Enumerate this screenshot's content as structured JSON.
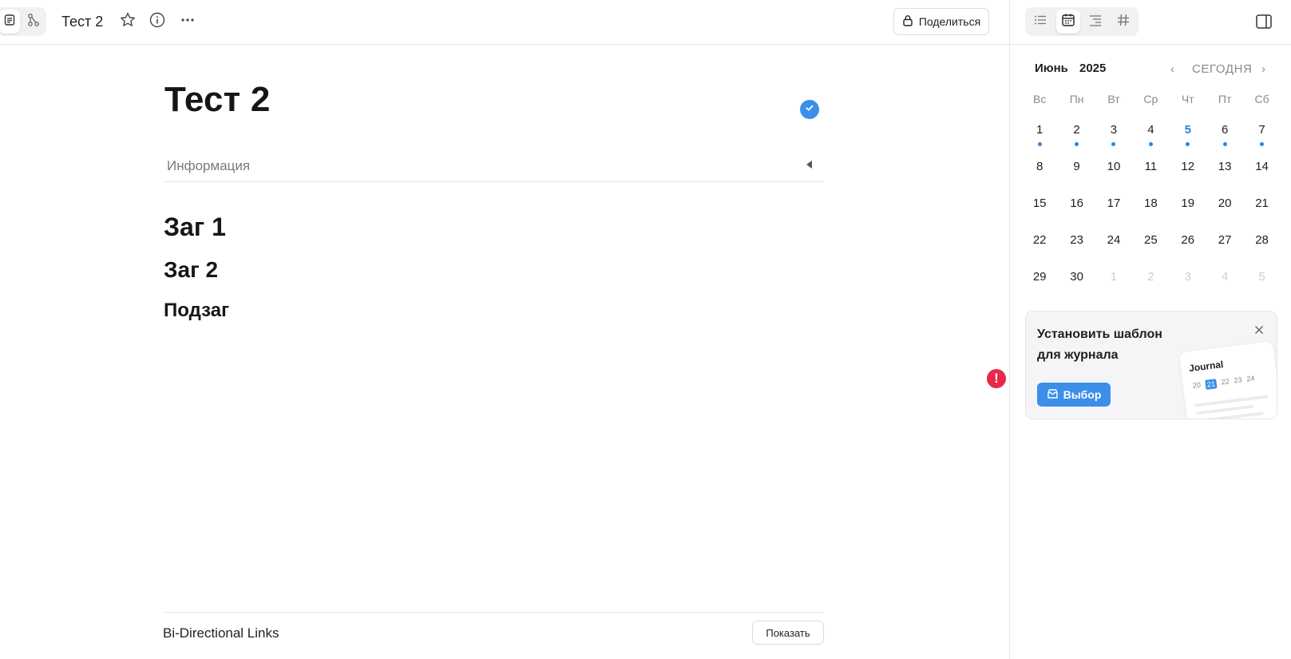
{
  "topbar": {
    "doc_title": "Тест 2",
    "share_label": "Поделиться"
  },
  "document": {
    "title": "Тест 2",
    "info_label": "Информация",
    "headings": [
      "Заг 1",
      "Заг 2",
      "Подзаг"
    ],
    "links_label": "Bi-Directional Links",
    "show_label": "Показать",
    "error_mark": "!"
  },
  "calendar": {
    "month": "Июнь",
    "year": "2025",
    "today_label": "СЕГОДНЯ",
    "prev_glyph": "‹",
    "next_glyph": "›",
    "weekdays": [
      "Вс",
      "Пн",
      "Вт",
      "Ср",
      "Чт",
      "Пт",
      "Сб"
    ],
    "weeks": [
      [
        "1",
        "2",
        "3",
        "4",
        "5",
        "6",
        "7"
      ],
      [
        "8",
        "9",
        "10",
        "11",
        "12",
        "13",
        "14"
      ],
      [
        "15",
        "16",
        "17",
        "18",
        "19",
        "20",
        "21"
      ],
      [
        "22",
        "23",
        "24",
        "25",
        "26",
        "27",
        "28"
      ],
      [
        "29",
        "30",
        "1",
        "2",
        "3",
        "4",
        "5"
      ]
    ]
  },
  "template_card": {
    "title": "Установить шаблон для журнала",
    "button_label": "Выбор",
    "preview_title": "Journal",
    "preview_days": [
      "20",
      "21",
      "22",
      "23",
      "24"
    ]
  },
  "colors": {
    "accent": "#3b8fe8",
    "error": "#e8294a"
  }
}
